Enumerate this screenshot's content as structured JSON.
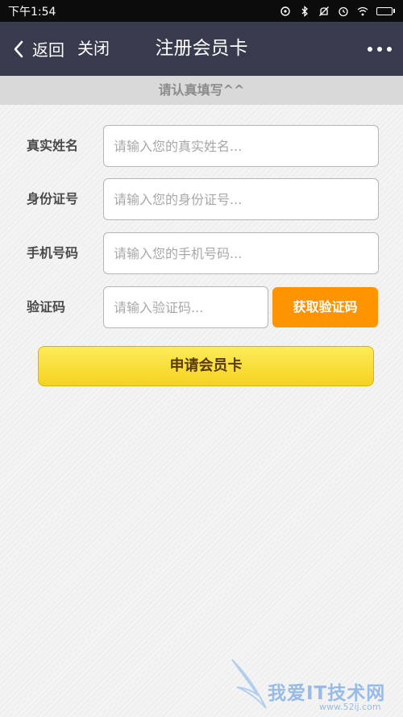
{
  "status_bar": {
    "time": "下午1:54",
    "icons": [
      "sync-icon",
      "bluetooth-icon",
      "mute-icon",
      "alarm-icon",
      "wifi-icon",
      "battery-icon"
    ],
    "battery_level": 0.85
  },
  "nav": {
    "back_label": "返回",
    "close_label": "关闭",
    "title": "注册会员卡",
    "more_icon": "more-dots-icon",
    "bg_color": "#383b4e"
  },
  "banner": {
    "text": "请认真填写^^"
  },
  "form": {
    "fields": [
      {
        "label": "真实姓名",
        "value": "",
        "placeholder": "请输入您的真实姓名..."
      },
      {
        "label": "身份证号",
        "value": "",
        "placeholder": "请输入您的身份证号..."
      },
      {
        "label": "手机号码",
        "value": "",
        "placeholder": "请输入您的手机号码..."
      },
      {
        "label": "验证码",
        "value": "",
        "placeholder": "请输入验证码..."
      }
    ],
    "get_code_label": "获取验证码",
    "get_code_color": "#fd9400",
    "submit_label": "申请会员卡",
    "submit_color": "#fbe23d"
  },
  "watermark": {
    "text": "我爱IT技术网",
    "subtext": "www.52ij.com"
  }
}
